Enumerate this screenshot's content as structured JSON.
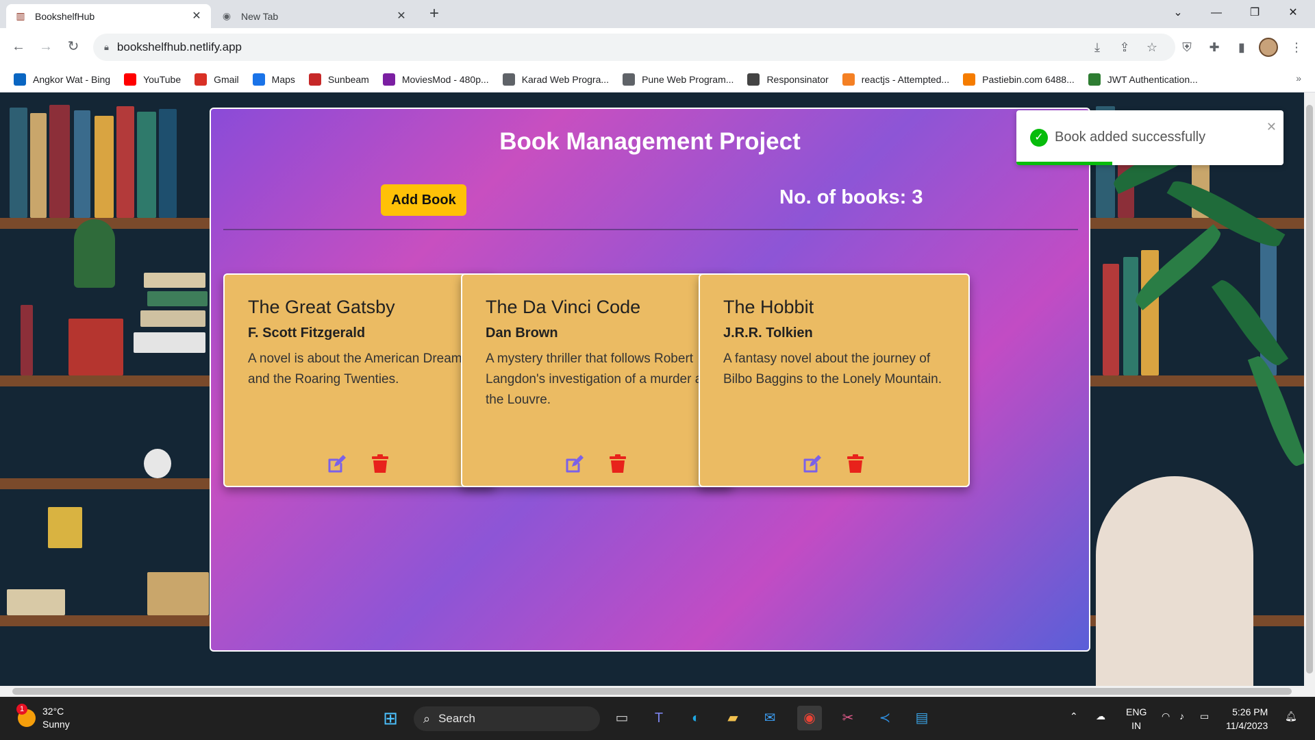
{
  "browser": {
    "tabs": [
      {
        "title": "BookshelfHub",
        "active": true
      },
      {
        "title": "New Tab",
        "active": false
      }
    ],
    "url": "bookshelfhub.netlify.app",
    "bookmarks": [
      {
        "label": "Angkor Wat - Bing",
        "icon": "search-icon",
        "color": "#0a66c2"
      },
      {
        "label": "YouTube",
        "icon": "youtube-icon",
        "color": "#ff0000"
      },
      {
        "label": "Gmail",
        "icon": "gmail-icon",
        "color": "#d93025"
      },
      {
        "label": "Maps",
        "icon": "maps-icon",
        "color": "#1a73e8"
      },
      {
        "label": "Sunbeam",
        "icon": "sunbeam-icon",
        "color": "#c62828"
      },
      {
        "label": "MoviesMod - 480p...",
        "icon": "moviesmod-icon",
        "color": "#7b1fa2"
      },
      {
        "label": "Karad Web Progra...",
        "icon": "globe-icon",
        "color": "#5f6368"
      },
      {
        "label": "Pune Web Program...",
        "icon": "globe-icon",
        "color": "#5f6368"
      },
      {
        "label": "Responsinator",
        "icon": "responsinator-icon",
        "color": "#444444"
      },
      {
        "label": "reactjs - Attempted...",
        "icon": "stackoverflow-icon",
        "color": "#f48024"
      },
      {
        "label": "Pastiebin.com 6488...",
        "icon": "pastebin-icon",
        "color": "#f57c00"
      },
      {
        "label": "JWT Authentication...",
        "icon": "link-icon",
        "color": "#2e7d32"
      }
    ]
  },
  "app": {
    "title": "Book Management Project",
    "add_button_label": "Add Book",
    "count_label": "No. of books: 3",
    "books": [
      {
        "title": "The Great Gatsby",
        "author": "F. Scott Fitzgerald",
        "description": "A novel is about the American Dream and the Roaring Twenties."
      },
      {
        "title": "The Da Vinci Code",
        "author": "Dan Brown",
        "description": "A mystery thriller that follows Robert Langdon's investigation of a murder at the Louvre."
      },
      {
        "title": "The Hobbit",
        "author": "J.R.R. Tolkien",
        "description": "A fantasy novel about the journey of Bilbo Baggins to the Lonely Mountain."
      }
    ],
    "colors": {
      "card": "#ebbb63",
      "edit": "#7b61e8",
      "delete": "#e8221b",
      "add_button": "#ffc107"
    }
  },
  "toast": {
    "message": "Book added successfully",
    "progress": 0.36
  },
  "taskbar": {
    "weather_temp": "32°C",
    "weather_cond": "Sunny",
    "weather_badge": "1",
    "search_label": "Search",
    "lang_top": "ENG",
    "lang_bottom": "IN",
    "time": "5:26 PM",
    "date": "11/4/2023"
  }
}
